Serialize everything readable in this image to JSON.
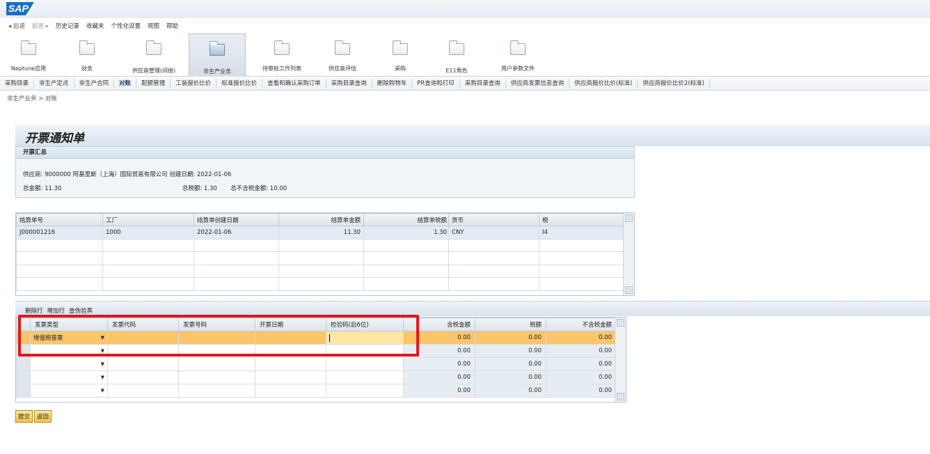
{
  "app": {
    "logo": "SAP"
  },
  "menu": {
    "back": "◂ 后退",
    "forward": "前进 ▸",
    "items": [
      "历史记录",
      "收藏夹",
      "个性化设置",
      "视图",
      "帮助"
    ]
  },
  "roles": [
    {
      "label": "Neptune应用"
    },
    {
      "label": "财务"
    },
    {
      "label": "供应商管理(间接)"
    },
    {
      "label": "非生产业务"
    },
    {
      "label": "待审批工作列表"
    },
    {
      "label": "供应商评估"
    },
    {
      "label": "采购"
    },
    {
      "label": "E11角色"
    },
    {
      "label": "用户参数文件"
    }
  ],
  "sub_tabs": [
    "采购目录",
    "非生产定点",
    "非生产合同",
    "对账",
    "配额管理",
    "工装报价比价",
    "标准报价比价",
    "查看和确认采购订单",
    "采购目录查询",
    "删除购物车",
    "PR查询和打印",
    "采购目录查询",
    "供应商发票信息查询",
    "供应商报价比价(标准)",
    "供应商报价比价2(标准)"
  ],
  "breadcrumb": "非生产业务 > 对账",
  "page": {
    "title": "开票通知单",
    "summary_title": "开票汇总",
    "summary_line1": "供应商: 9000000 阿基里斯（上海）国际贸易有限公司 创建日期: 2022-01-06",
    "total_amount": "总金额: 11.30",
    "total_tax": "总税额: 1.30",
    "total_net": "总不含税金额: 10.00"
  },
  "settlement_table": {
    "columns": [
      "结算单号",
      "工厂",
      "结算单创建日期",
      "结算单金额",
      "结算单税额",
      "货币",
      "税"
    ],
    "rows": [
      [
        "J000001216",
        "1000",
        "2022-01-06",
        "11.30",
        "1.30",
        "CNY",
        "I4"
      ]
    ]
  },
  "invoice_table": {
    "actions": [
      "删除行",
      "增加行",
      "查伪验真"
    ],
    "columns": [
      "发票类型",
      "发票代码",
      "发票号码",
      "开票日期",
      "检验码(后6位)",
      "含税金额",
      "税额",
      "不含税金额"
    ],
    "rows": [
      {
        "type": "增值税普票",
        "gross": "0.00",
        "tax": "0.00",
        "net": "0.00"
      },
      {
        "type": "",
        "gross": "0.00",
        "tax": "0.00",
        "net": "0.00"
      },
      {
        "type": "",
        "gross": "0.00",
        "tax": "0.00",
        "net": "0.00"
      },
      {
        "type": "",
        "gross": "0.00",
        "tax": "0.00",
        "net": "0.00"
      },
      {
        "type": "",
        "gross": "0.00",
        "tax": "0.00",
        "net": "0.00"
      }
    ]
  },
  "buttons": {
    "submit": "提交",
    "back": "返回"
  },
  "colors": {
    "highlight": "#fbc56a",
    "annotation": "#e4161b"
  }
}
